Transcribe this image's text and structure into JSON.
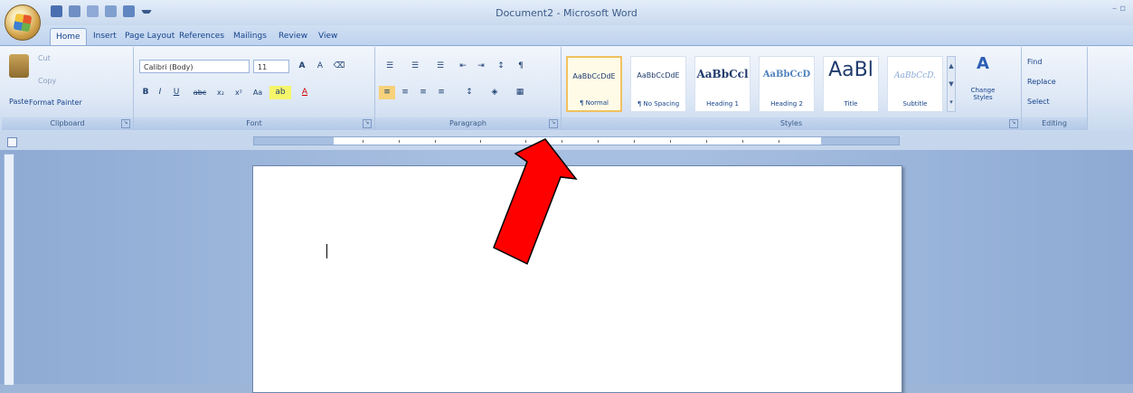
{
  "window": {
    "title": "Document2 - Microsoft Word"
  },
  "tabs": [
    "Home",
    "Insert",
    "Page Layout",
    "References",
    "Mailings",
    "Review",
    "View"
  ],
  "clipboard": {
    "paste": "Paste",
    "cut": "Cut",
    "copy": "Copy",
    "format_painter": "Format Painter",
    "label": "Clipboard"
  },
  "font": {
    "name": "Calibri (Body)",
    "size": "11",
    "label": "Font",
    "buttons": [
      "B",
      "I",
      "U",
      "abc",
      "x₂",
      "x²",
      "Aa",
      "A"
    ]
  },
  "paragraph": {
    "label": "Paragraph"
  },
  "styles": {
    "label": "Styles",
    "items": [
      {
        "sample": "AaBbCcDdE",
        "name": "¶ Normal"
      },
      {
        "sample": "AaBbCcDdE",
        "name": "¶ No Spacing"
      },
      {
        "sample": "AaBbCcl",
        "name": "Heading 1"
      },
      {
        "sample": "AaBbCcD",
        "name": "Heading 2"
      },
      {
        "sample": "AaBl",
        "name": "Title"
      },
      {
        "sample": "AaBbCcD.",
        "name": "Subtitle"
      }
    ],
    "change_styles": "Change Styles"
  },
  "editing": {
    "label": "Editing",
    "find": "Find",
    "replace": "Replace",
    "select": "Select"
  },
  "annotation": {
    "arrow_color": "#ff0000"
  }
}
